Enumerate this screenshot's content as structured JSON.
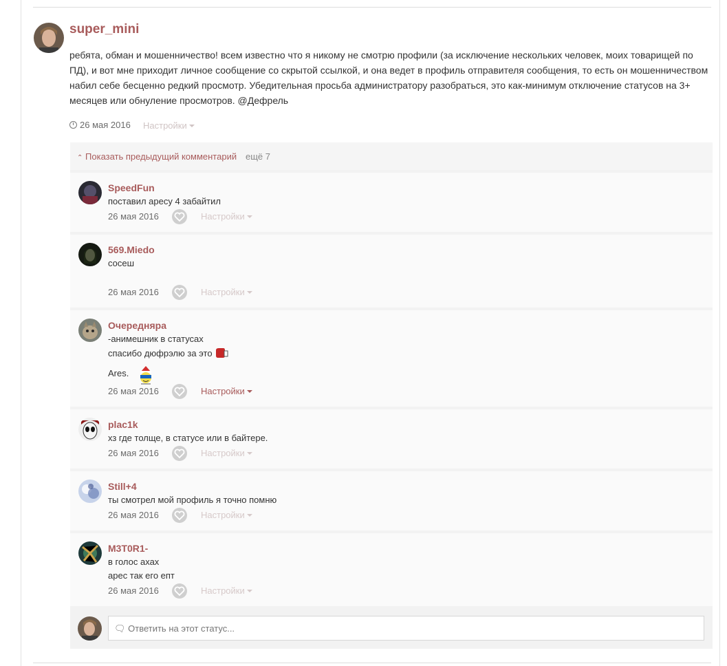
{
  "post": {
    "author": "super_mini",
    "text": "ребята, обман и мошенничество! всем известно что я никому не смотрю профили (за исключение нескольких человек, моих товарищей по ПД), и вот мне приходит личное сообщение со скрытой ссылкой, и она ведет в профиль отправителя сообщения, то есть он мошенничеством набил себе бесценно редкий просмотр. Убедительная просьба администратору разобраться, это как-минимум отключение статусов на 3+ месяцев или обнуление просмотров. @Дефрель",
    "date": "26 мая 2016",
    "settings_label": "Настройки"
  },
  "show_previous": {
    "label": "Показать предыдущий комментарий",
    "more": "ещё 7"
  },
  "comments": [
    {
      "author": "SpeedFun",
      "lines": [
        "поставил аресу 4 забайтил"
      ],
      "date": "26 мая 2016",
      "settings": "Настройки"
    },
    {
      "author": "569.Miedo",
      "lines": [
        "сосеш"
      ],
      "date": "26 мая 2016",
      "settings": "Настройки"
    },
    {
      "author": "Очередняра",
      "lines": [
        "-анимешник в статусах",
        "спасибо дюфрэлю за это",
        "Ares."
      ],
      "date": "26 мая 2016",
      "settings": "Настройки"
    },
    {
      "author": "plac1k",
      "lines": [
        "хз где толще, в статусе или в байтере."
      ],
      "date": "26 мая 2016",
      "settings": "Настройки"
    },
    {
      "author": "Still+4",
      "lines": [
        "ты смотрел мой профиль я точно помню"
      ],
      "date": "26 мая 2016",
      "settings": "Настройки"
    },
    {
      "author": "M3T0R1-",
      "lines": [
        "в голос ахах",
        "арес так его епт"
      ],
      "date": "26 мая 2016",
      "settings": "Настройки"
    }
  ],
  "reply": {
    "placeholder": "Ответить на этот статус..."
  },
  "icons": {
    "clock": "clock-icon",
    "like": "heart-icon",
    "caret": "caret-down-icon",
    "chevron": "chevron-up-icon",
    "comment": "speech-bubble-icon"
  },
  "colors": {
    "accent": "#a85b5b",
    "muted_settings": "#d6c9c9"
  }
}
